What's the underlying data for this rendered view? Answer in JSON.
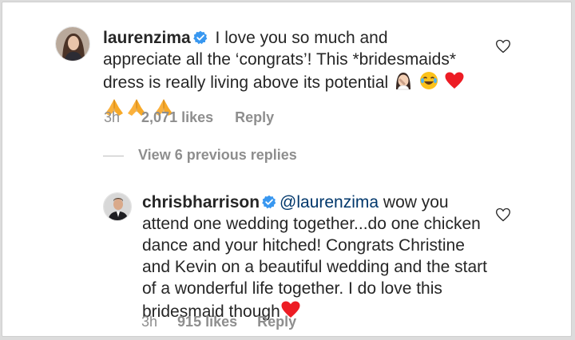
{
  "comments": [
    {
      "username": "laurenzima",
      "verified": true,
      "text_part1": " I love you so much and appreciate all the ‘congrats’! This *bridesmaids* dress is really living above its potential ",
      "emoji_icons": [
        "woman-facepalming-icon",
        "joy-icon",
        "red-heart-icon",
        "folded-hands-icon",
        "folded-hands-icon",
        "folded-hands-icon"
      ],
      "time": "3h",
      "likes": "2,071 likes",
      "reply_label": "Reply"
    },
    {
      "username": "chrisbharrison",
      "verified": true,
      "mention": "@laurenzima",
      "text_body": " wow you attend one wedding together...do one chicken dance and your hitched!  Congrats Christine and Kevin on a beautiful wedding and the start of a wonderful life together.  I do love this bridesmaid though",
      "emoji_icons": [
        "red-heart-icon"
      ],
      "time": "3h",
      "likes": "915 likes",
      "reply_label": "Reply"
    }
  ],
  "view_replies_label": "View 6 previous replies",
  "colors": {
    "text": "#262626",
    "muted": "#8e8e8e",
    "mention": "#00376b",
    "verified": "#3897f0",
    "heart": "#ed1c24"
  }
}
